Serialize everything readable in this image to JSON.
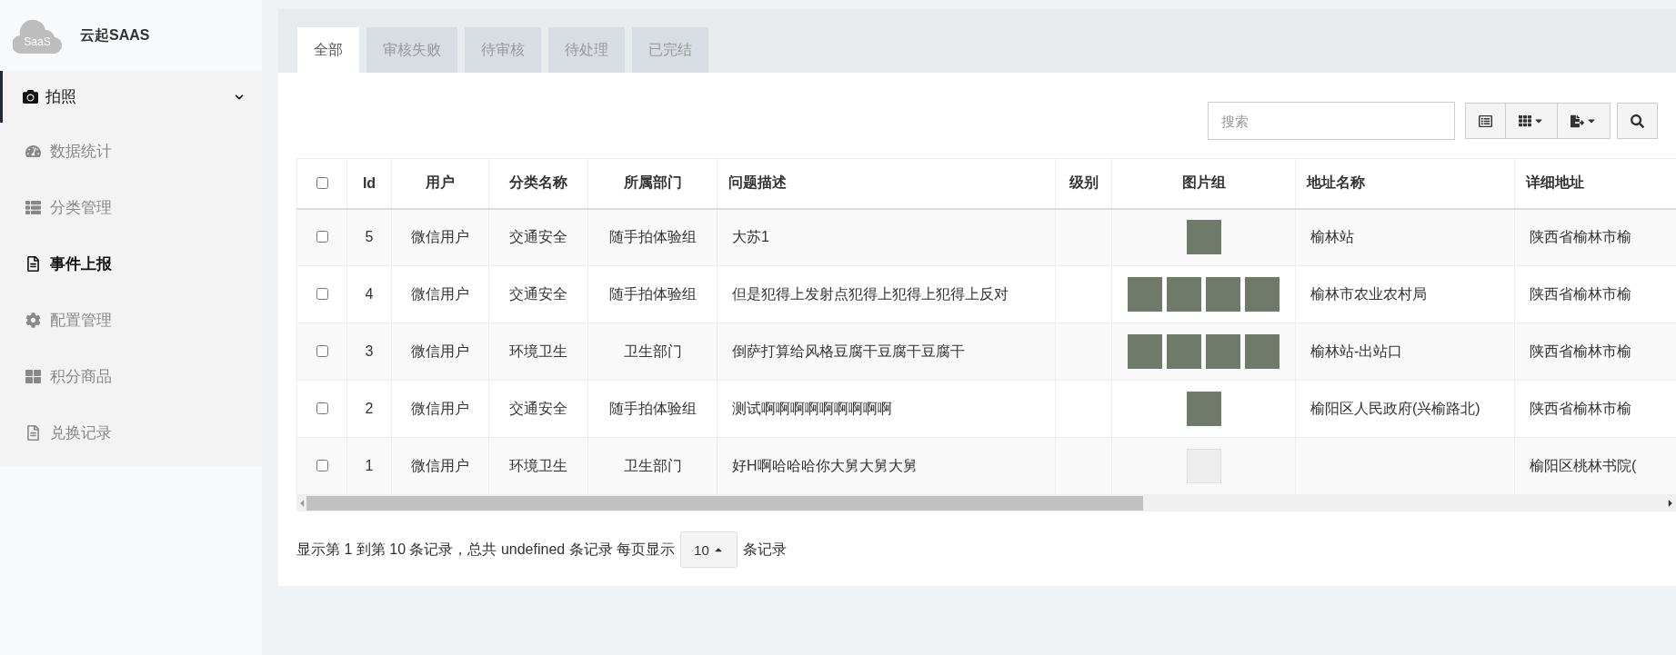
{
  "sidebar": {
    "logo_text": "SaaS",
    "brand": "云起SAAS",
    "menu": [
      {
        "label": "拍照",
        "expanded": true,
        "children": [
          {
            "label": "数据统计",
            "selected": false
          },
          {
            "label": "分类管理",
            "selected": false
          },
          {
            "label": "事件上报",
            "selected": true
          },
          {
            "label": "配置管理",
            "selected": false
          },
          {
            "label": "积分商品",
            "selected": false
          },
          {
            "label": "兑换记录",
            "selected": false
          }
        ]
      }
    ]
  },
  "tabs": [
    {
      "label": "全部",
      "selected": true
    },
    {
      "label": "审核失败",
      "selected": false
    },
    {
      "label": "待审核",
      "selected": false
    },
    {
      "label": "待处理",
      "selected": false
    },
    {
      "label": "已完结",
      "selected": false
    }
  ],
  "search": {
    "placeholder": "搜索"
  },
  "table": {
    "select_all_checked": false,
    "columns": [
      "Id",
      "用户",
      "分类名称",
      "所属部门",
      "问题描述",
      "级别",
      "图片组",
      "地址名称",
      "详细地址"
    ],
    "rows": [
      {
        "checked": false,
        "id": "5",
        "user": "微信用户",
        "category": "交通安全",
        "department": "随手拍体验组",
        "description": "大苏1",
        "level": "",
        "images": [
          {
            "kind": "photo"
          }
        ],
        "address_name": "榆林站",
        "address_detail": "陕西省榆林市榆"
      },
      {
        "checked": false,
        "id": "4",
        "user": "微信用户",
        "category": "交通安全",
        "department": "随手拍体验组",
        "description": "但是犯得上发射点犯得上犯得上犯得上反对",
        "level": "",
        "images": [
          {
            "kind": "photo"
          },
          {
            "kind": "photo"
          },
          {
            "kind": "photo"
          },
          {
            "kind": "photo"
          }
        ],
        "address_name": "榆林市农业农村局",
        "address_detail": "陕西省榆林市榆"
      },
      {
        "checked": false,
        "id": "3",
        "user": "微信用户",
        "category": "环境卫生",
        "department": "卫生部门",
        "description": "倒萨打算给风格豆腐干豆腐干豆腐干",
        "level": "",
        "images": [
          {
            "kind": "photo"
          },
          {
            "kind": "photo"
          },
          {
            "kind": "photo"
          },
          {
            "kind": "photo"
          }
        ],
        "address_name": "榆林站-出站口",
        "address_detail": "陕西省榆林市榆"
      },
      {
        "checked": false,
        "id": "2",
        "user": "微信用户",
        "category": "交通安全",
        "department": "随手拍体验组",
        "description": "测试啊啊啊啊啊啊啊啊啊",
        "level": "",
        "images": [
          {
            "kind": "photo"
          }
        ],
        "address_name": "榆阳区人民政府(兴榆路北)",
        "address_detail": "陕西省榆林市榆"
      },
      {
        "checked": false,
        "id": "1",
        "user": "微信用户",
        "category": "环境卫生",
        "department": "卫生部门",
        "description": "好H啊哈哈哈你大舅大舅大舅",
        "level": "",
        "images": [
          {
            "kind": "document"
          }
        ],
        "address_name": "",
        "address_detail": "榆阳区桃林书院("
      }
    ]
  },
  "pagination": {
    "summary": "显示第 1 到第 10 条记录，总共 undefined 条记录 每页显示",
    "page_size": "10",
    "suffix": "条记录"
  }
}
